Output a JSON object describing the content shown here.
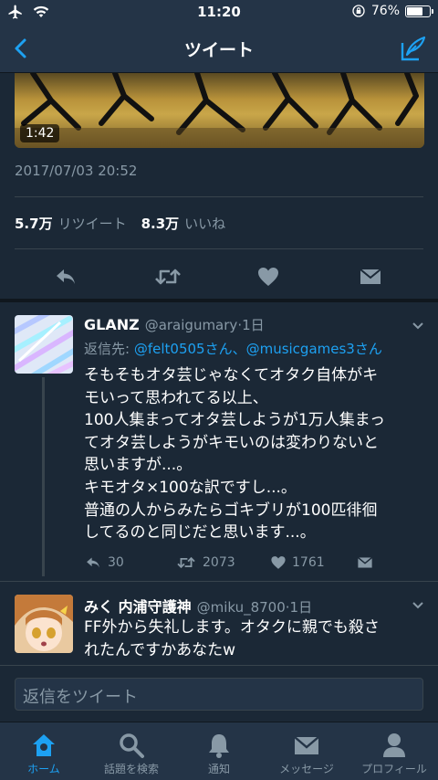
{
  "status_bar": {
    "time": "11:20",
    "battery": "76%",
    "battery_level": 0.76
  },
  "nav": {
    "title": "ツイート",
    "back_icon": "chevron-left-icon",
    "compose_icon": "compose-icon"
  },
  "tweet": {
    "video_duration": "1:42",
    "timestamp": "2017/07/03 20:52",
    "retweets": "5.7万",
    "retweets_label": "リツイート",
    "likes": "8.3万",
    "likes_label": "いいね"
  },
  "replies": [
    {
      "name": "GLANZ",
      "handle": "@araigumary",
      "time": "1日",
      "reply_to_label": "返信先:",
      "reply_to_mentions": "@felt0505さん、@musicgames3さん",
      "lines": [
        "そもそもオタ芸じゃなくてオタク自体がキ",
        "モいって思われてる以上、",
        "100人集まってオタ芸しようが1万人集まっ",
        "てオタ芸しようがキモいのは変わりないと",
        "思いますが...。",
        "キモオタ×100な訳ですし...。",
        "普通の人からみたらゴキブリが100匹徘徊",
        "してるのと同じだと思います...。"
      ],
      "reply_count": "30",
      "retweet_count": "2073",
      "like_count": "1761"
    },
    {
      "name": "みく 内浦守護神",
      "handle": "@miku_8700",
      "time": "1日",
      "lines": [
        "FF外から失礼します。オタクに親でも殺さ",
        "れたんですかあなたw"
      ]
    }
  ],
  "reply_input": {
    "placeholder": "返信をツイート"
  },
  "tabbar": {
    "home": "ホーム",
    "search": "話題を検索",
    "notifications": "通知",
    "messages": "メッセージ",
    "profile": "プロフィール"
  },
  "colors": {
    "accent": "#1da1f2",
    "background": "#141d26",
    "panel": "#243447",
    "secondary_text": "#8899a6"
  }
}
